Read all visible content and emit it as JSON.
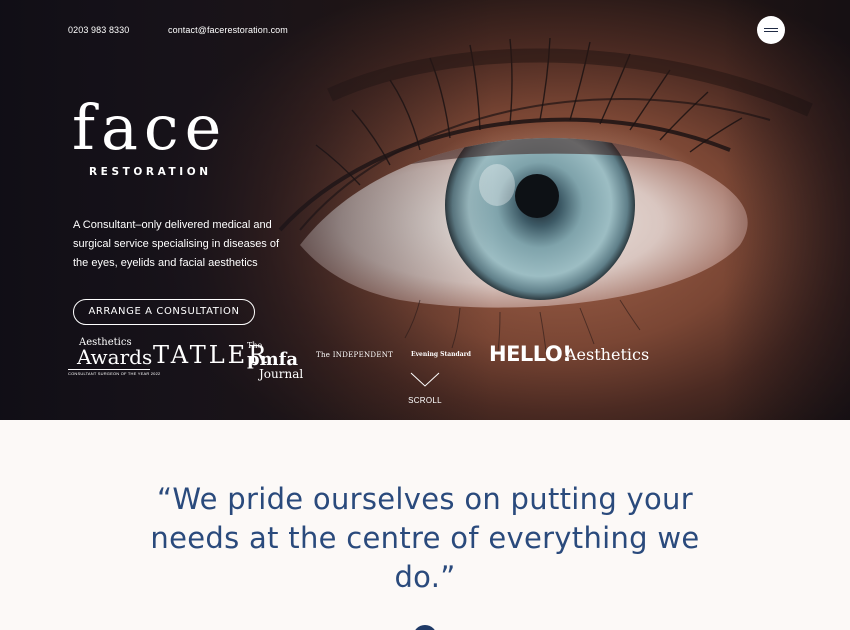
{
  "header": {
    "phone": "0203 983 8330",
    "email": "contact@facerestoration.com",
    "menu_icon": "hamburger-icon"
  },
  "logo": {
    "word": "face",
    "sub": "RESTORATION"
  },
  "hero": {
    "tagline": "A Consultant–only delivered medical and surgical service specialising in diseases of the eyes, eyelids and facial aesthetics",
    "cta_label": "ARRANGE A CONSULTATION",
    "scroll_label": "SCROLL"
  },
  "press": {
    "aesthetics_awards": {
      "line1": "Aesthetics",
      "line2": "Awards",
      "line3": "CONSULTANT SURGEON OF THE YEAR 2022"
    },
    "tatler": "TATLER",
    "pmfa": {
      "line1": "The",
      "line2": "pmfa",
      "line3": "Journal"
    },
    "independent": "The INDEPENDENT",
    "standard": "Evening Standard",
    "hello": "HELLO!",
    "aesthetics": "Aesthetics"
  },
  "quote": {
    "text": "“We pride ourselves on putting your needs at the centre of everything we do.”"
  },
  "colors": {
    "brand_navy": "#2a4a7c",
    "background": "#fcf9f7",
    "hero_dark": "#17131a"
  }
}
